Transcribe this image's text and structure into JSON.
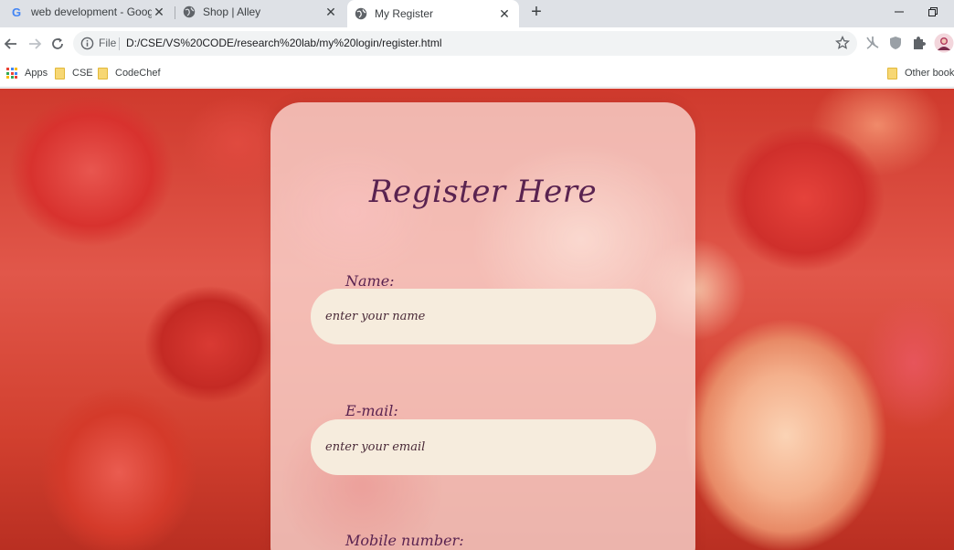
{
  "browser": {
    "tabs": [
      {
        "title": "web development - Google Search",
        "favicon": "google-g-icon",
        "active": false
      },
      {
        "title": "Shop | Alley",
        "favicon": "globe-icon",
        "active": false
      },
      {
        "title": "My Register",
        "favicon": "globe-icon",
        "active": true
      }
    ],
    "omnibox": {
      "scheme_label": "File",
      "url": "D:/CSE/VS%20CODE/research%20lab/my%20login/register.html"
    },
    "bookmarks": [
      {
        "label": "Apps",
        "icon": "apps-grid-icon"
      },
      {
        "label": "CSE",
        "icon": "folder-icon"
      },
      {
        "label": "CodeChef",
        "icon": "folder-icon"
      }
    ],
    "other_bookmarks": "Other bookmarks"
  },
  "page": {
    "title": "Register Here",
    "fields": [
      {
        "label": "Name:",
        "placeholder": "enter your name"
      },
      {
        "label": "E-mail:",
        "placeholder": "enter your email"
      },
      {
        "label": "Mobile number:"
      }
    ]
  },
  "colors": {
    "heading": "#5a2350",
    "input_background": "#f6ecdd",
    "background_theme": "#d8322e"
  }
}
